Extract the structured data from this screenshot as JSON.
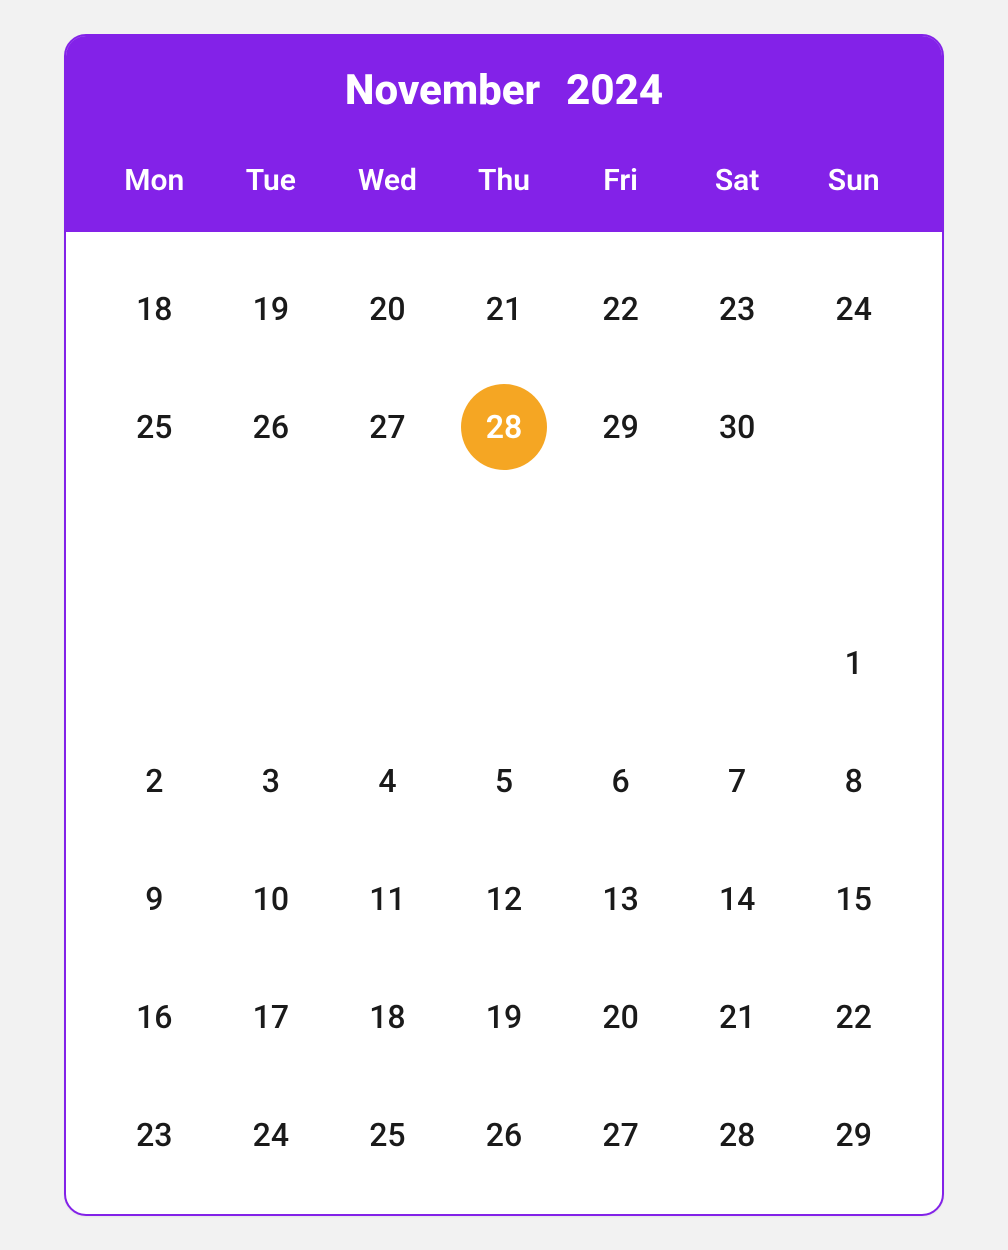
{
  "header": {
    "month": "November",
    "year": "2024",
    "weekdays": [
      "Mon",
      "Tue",
      "Wed",
      "Thu",
      "Fri",
      "Sat",
      "Sun"
    ]
  },
  "rows": [
    [
      {
        "v": "18"
      },
      {
        "v": "19"
      },
      {
        "v": "20"
      },
      {
        "v": "21"
      },
      {
        "v": "22"
      },
      {
        "v": "23"
      },
      {
        "v": "24"
      }
    ],
    [
      {
        "v": "25"
      },
      {
        "v": "26"
      },
      {
        "v": "27"
      },
      {
        "v": "28",
        "highlight": true
      },
      {
        "v": "29"
      },
      {
        "v": "30"
      },
      {
        "v": ""
      }
    ],
    [
      {
        "v": ""
      },
      {
        "v": ""
      },
      {
        "v": ""
      },
      {
        "v": ""
      },
      {
        "v": ""
      },
      {
        "v": ""
      },
      {
        "v": ""
      }
    ],
    [
      {
        "v": ""
      },
      {
        "v": ""
      },
      {
        "v": ""
      },
      {
        "v": ""
      },
      {
        "v": ""
      },
      {
        "v": ""
      },
      {
        "v": "1"
      }
    ],
    [
      {
        "v": "2"
      },
      {
        "v": "3"
      },
      {
        "v": "4"
      },
      {
        "v": "5"
      },
      {
        "v": "6"
      },
      {
        "v": "7"
      },
      {
        "v": "8"
      }
    ],
    [
      {
        "v": "9"
      },
      {
        "v": "10"
      },
      {
        "v": "11"
      },
      {
        "v": "12"
      },
      {
        "v": "13"
      },
      {
        "v": "14"
      },
      {
        "v": "15"
      }
    ],
    [
      {
        "v": "16"
      },
      {
        "v": "17"
      },
      {
        "v": "18"
      },
      {
        "v": "19"
      },
      {
        "v": "20"
      },
      {
        "v": "21"
      },
      {
        "v": "22"
      }
    ],
    [
      {
        "v": "23"
      },
      {
        "v": "24"
      },
      {
        "v": "25"
      },
      {
        "v": "26"
      },
      {
        "v": "27"
      },
      {
        "v": "28"
      },
      {
        "v": "29"
      }
    ]
  ]
}
